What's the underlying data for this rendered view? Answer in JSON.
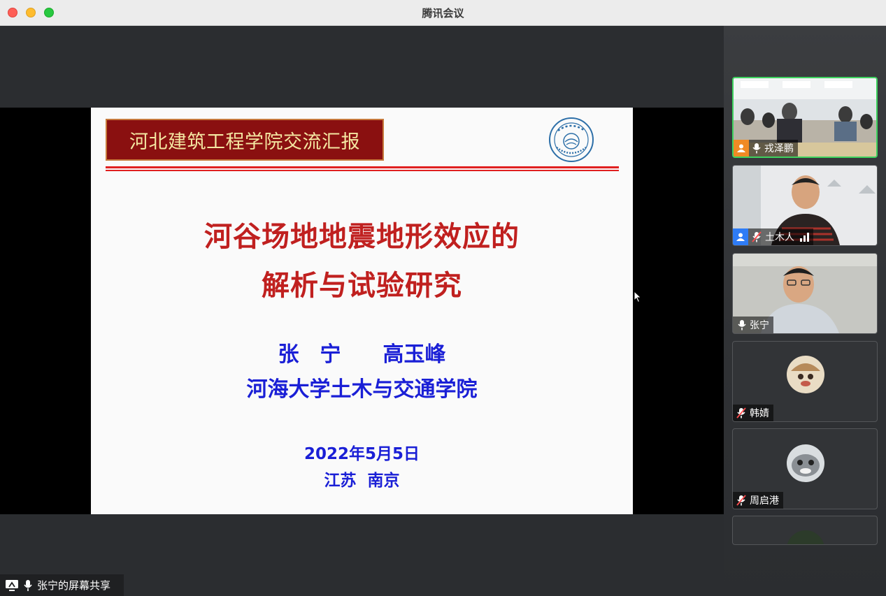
{
  "window": {
    "title": "腾讯会议"
  },
  "slide": {
    "header": "河北建筑工程学院交流汇报",
    "title_line1": "河谷场地地震地形效应的",
    "title_line2": "解析与试验研究",
    "authors": "张　宁　　高玉峰",
    "affiliation": "河海大学土木与交通学院",
    "date": "2022年5月5日",
    "place": "江苏  南京",
    "seal_text": "HOHAI UNIVERSITY"
  },
  "share": {
    "label": "张宁的屏幕共享"
  },
  "participants": [
    {
      "name": "戎泽鹏",
      "role": "host",
      "mic": "on",
      "video": "room"
    },
    {
      "name": "土木人",
      "role": "cohost",
      "mic": "muted",
      "video": "person"
    },
    {
      "name": "张宁",
      "role": "none",
      "mic": "on",
      "video": "person"
    },
    {
      "name": "韩婧",
      "role": "none",
      "mic": "muted",
      "video": "avatar"
    },
    {
      "name": "周启港",
      "role": "none",
      "mic": "muted",
      "video": "avatar"
    }
  ],
  "colors": {
    "active_speaker": "#3ed25f",
    "slide_title": "#c0201f",
    "slide_body": "#1a1fd6",
    "header_bg": "#8a1010"
  }
}
